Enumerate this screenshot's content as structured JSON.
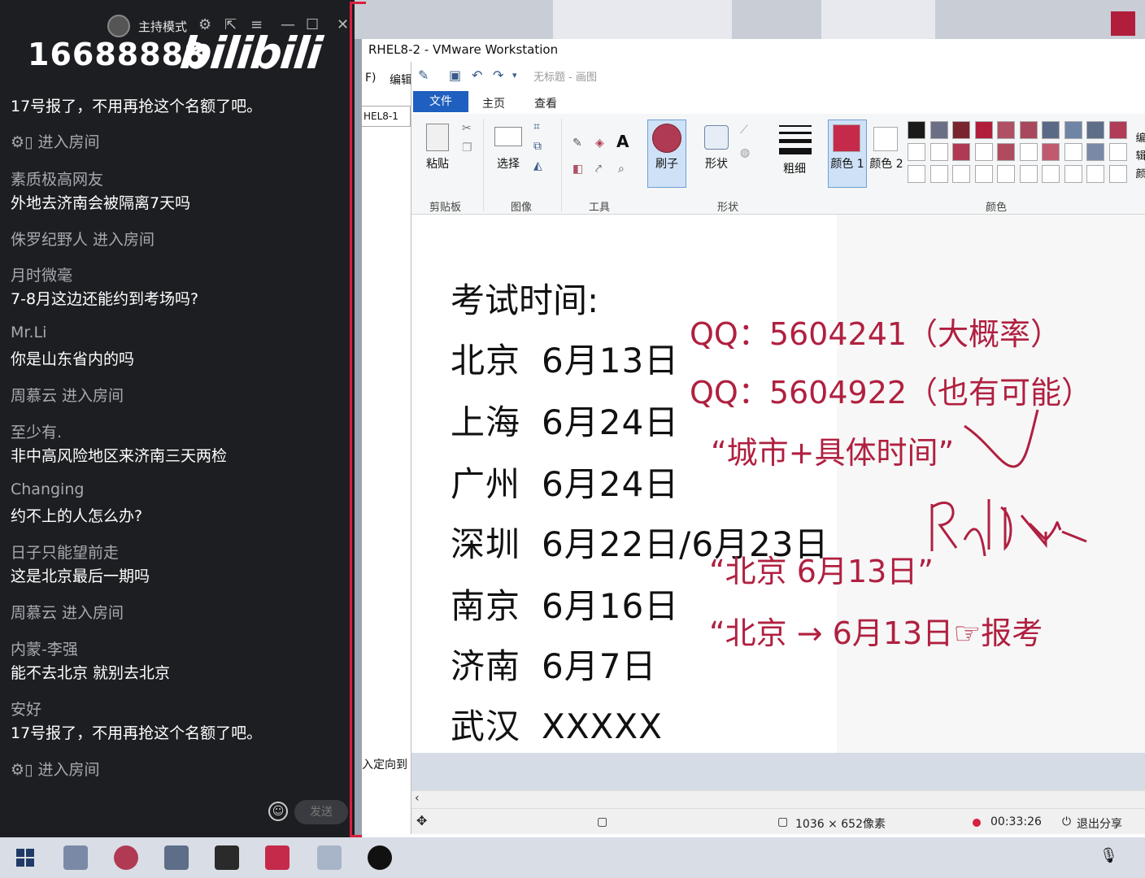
{
  "chat": {
    "host_mode": "主持模式",
    "room_id": "16688888",
    "logo": "bilibili",
    "messages": [
      {
        "text": "17号报了，不用再抢这个名额了吧。"
      },
      {
        "enter": "⚙▯ 进入房间"
      },
      {
        "user": "素质极高网友",
        "text": "外地去济南会被隔离7天吗"
      },
      {
        "enter": "侏罗纪野人 进入房间"
      },
      {
        "user": "月时微毫",
        "text": "7-8月这边还能约到考场吗?"
      },
      {
        "user": "Mr.Li",
        "text": "你是山东省内的吗"
      },
      {
        "enter": "周慕云 进入房间"
      },
      {
        "user": "至少有.",
        "text": "非中高风险地区来济南三天两检"
      },
      {
        "user": "Changing",
        "text": "约不上的人怎么办?"
      },
      {
        "user": "日子只能望前走",
        "text": "这是北京最后一期吗"
      },
      {
        "enter": "周慕云 进入房间"
      },
      {
        "user": "内蒙-李强",
        "text": "能不去北京 就别去北京"
      },
      {
        "user": "安好",
        "text": "17号报了，不用再抢这个名额了吧。"
      },
      {
        "enter": "⚙▯ 进入房间"
      }
    ],
    "send_label": "发送"
  },
  "vmware": {
    "title": "RHEL8-2 - VMware Workstation",
    "menu_f": "F)",
    "menu_edit": "编辑",
    "tab": "HEL8-1",
    "status_text": "入定向到"
  },
  "paint": {
    "title": "无标题 - 画图",
    "tabs": [
      "文件",
      "主页",
      "查看"
    ],
    "groups": [
      "剪贴板",
      "图像",
      "工具",
      "形状",
      "颜色"
    ],
    "buttons": {
      "paste": "粘贴",
      "select": "选择",
      "brush": "刷子",
      "shapes": "形状",
      "size": "粗细",
      "color1": "颜色 1",
      "color2": "颜色 2",
      "edit": "编辑颜"
    },
    "palette_row1": [
      "#1a1a1a",
      "#6b6f86",
      "#7a2430",
      "#b01e3c",
      "#b05064",
      "#a8485c",
      "#5a6a86",
      "#6e85a6",
      "#5e6e88",
      "#b03c58"
    ],
    "palette_row2": [
      "#ffffff",
      "#ffffff",
      "#b03a54",
      "#ffffff",
      "#b04a5e",
      "#ffffff",
      "#c05a6e",
      "#ffffff",
      "#7a8aa6",
      "#ffffff"
    ],
    "color1_value": "#c62a4a",
    "color2_value": "#ffffff",
    "canvas_title": "考试时间:",
    "schedule": [
      {
        "city": "北京",
        "date": "6月13日"
      },
      {
        "city": "上海",
        "date": "6月24日"
      },
      {
        "city": "广州",
        "date": "6月24日"
      },
      {
        "city": "深圳",
        "date": "6月22日/6月23日"
      },
      {
        "city": "南京",
        "date": "6月16日"
      },
      {
        "city": "济南",
        "date": "6月7日"
      },
      {
        "city": "武汉",
        "date": "XXXXX"
      }
    ],
    "notes": {
      "qq1": "QQ：5604241（大概率）",
      "qq2": "QQ：5604922（也有可能）",
      "format": "“城市+具体时间”",
      "example1": "“北京 6月13日”",
      "example2": "“北京 → 6月13日☞报考"
    },
    "status_size": "1036 × 652像素",
    "status_time": "00:33:26",
    "status_exit": "退出分享"
  },
  "colors": {
    "accent_red": "#d8203f",
    "note_red": "#b02040",
    "chat_bg": "#1d1e22",
    "paint_blue": "#1e5fbf"
  }
}
